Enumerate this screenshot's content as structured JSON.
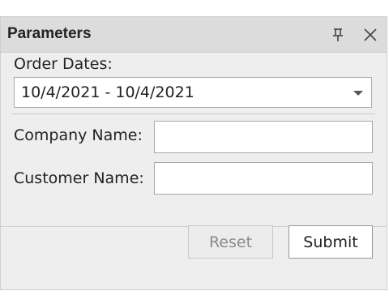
{
  "panel": {
    "title": "Parameters",
    "pin_icon": "pin-icon",
    "close_icon": "close-icon"
  },
  "fields": {
    "order_dates": {
      "label": "Order Dates:",
      "value": "10/4/2021 - 10/4/2021"
    },
    "company_name": {
      "label": "Company Name:",
      "value": ""
    },
    "customer_name": {
      "label": "Customer Name:",
      "value": ""
    }
  },
  "buttons": {
    "reset_label": "Reset",
    "submit_label": "Submit"
  }
}
